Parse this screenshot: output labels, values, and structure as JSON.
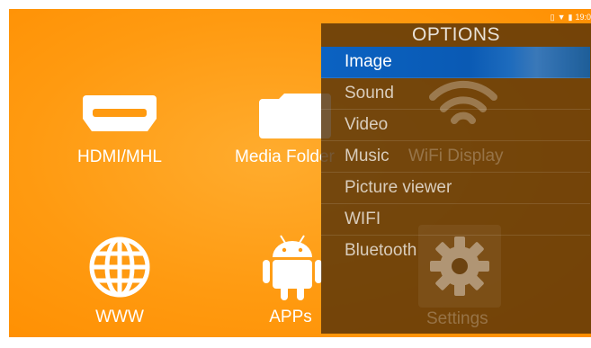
{
  "status_bar": {
    "time": "19:0"
  },
  "home_tiles": [
    {
      "name": "hdmi",
      "label": "HDMI/MHL",
      "icon": "hdmi-icon"
    },
    {
      "name": "media-folder",
      "label": "Media Folder",
      "icon": "folder-icon"
    },
    {
      "name": "www",
      "label": "WWW",
      "icon": "globe-icon"
    },
    {
      "name": "apps",
      "label": "APPs",
      "icon": "android-icon"
    }
  ],
  "options_menu": {
    "title": "OPTIONS",
    "items": [
      "Image",
      "Sound",
      "Video",
      "Music",
      "Picture viewer",
      "WIFI",
      "Bluetooth"
    ],
    "selected": "Image"
  },
  "background_tiles": [
    {
      "name": "wifi-display",
      "label": "WiFi Display",
      "icon": "wifi-icon"
    },
    {
      "name": "settings",
      "label": "Settings",
      "icon": "gear-icon"
    }
  ],
  "colors": {
    "background": "#ff9a10",
    "overlay": "#56320a",
    "selection": "#0b62c2"
  }
}
